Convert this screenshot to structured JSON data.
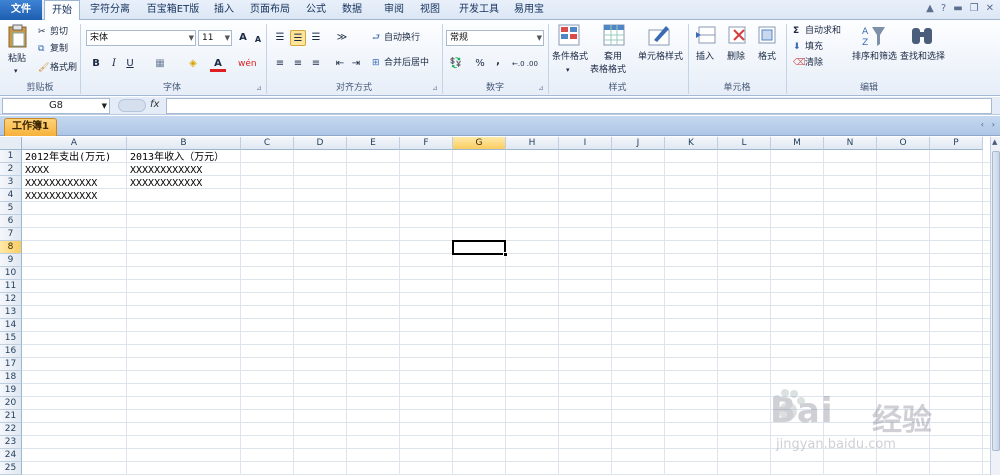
{
  "tabs": [
    "文件",
    "开始",
    "字符分离",
    "百宝箱ET版",
    "插入",
    "页面布局",
    "公式",
    "数据",
    "审阅",
    "视图",
    "开发工具",
    "易用宝"
  ],
  "clipboard": {
    "paste": "粘贴",
    "cut": "剪切",
    "copy": "复制",
    "format_painter": "格式刷",
    "label": "剪贴板"
  },
  "font": {
    "name": "宋体",
    "size": "11",
    "label": "字体",
    "bold": "B",
    "italic": "I",
    "underline": "U",
    "grow": "A",
    "shrink": "A",
    "fill_letter": "A"
  },
  "alignment": {
    "wrap": "自动换行",
    "merge": "合并后居中",
    "label": "对齐方式"
  },
  "number": {
    "format": "常规",
    "percent": "%",
    "comma": ",",
    "label": "数字",
    "inc_decimal": "←.0 .00",
    "dec_decimal": ".00 →.0"
  },
  "styles": {
    "cond_format": "条件格式",
    "table_format_1": "套用",
    "table_format_2": "表格格式",
    "cell_styles": "单元格样式",
    "label": "样式"
  },
  "cells": {
    "insert": "插入",
    "delete": "删除",
    "format": "格式",
    "label": "单元格"
  },
  "editing": {
    "autosum": "自动求和",
    "fill": "填充",
    "clear": "清除",
    "sort": "排序和筛选",
    "find": "查找和选择",
    "label": "编辑"
  },
  "formula_bar": {
    "name_box": "G8",
    "fx": "fx",
    "content": ""
  },
  "workbook_tab": "工作簿1",
  "columns": [
    "A",
    "B",
    "C",
    "D",
    "E",
    "F",
    "G",
    "H",
    "I",
    "J",
    "K",
    "L",
    "M",
    "N",
    "O",
    "P"
  ],
  "rows": [
    "1",
    "2",
    "3",
    "4",
    "5",
    "6",
    "7",
    "8",
    "9",
    "10",
    "11",
    "12",
    "13",
    "14",
    "15",
    "16",
    "17",
    "18",
    "19",
    "20",
    "21",
    "22",
    "23",
    "24",
    "25"
  ],
  "selected": {
    "column": "G",
    "row": "8"
  },
  "cell_values": {
    "A1": "2012年支出(万元)",
    "B1": "2013年收入（万元）",
    "A2": "XXXX",
    "B2": "XXXXXXXXXXXX",
    "A3": "XXXXXXXXXXXX",
    "B3": "XXXXXXXXXXXX",
    "A4": "XXXXXXXXXXXX"
  },
  "watermark": {
    "brand": "Bai",
    "brand_tail": "经验",
    "url": "jingyan.baidu.com"
  }
}
